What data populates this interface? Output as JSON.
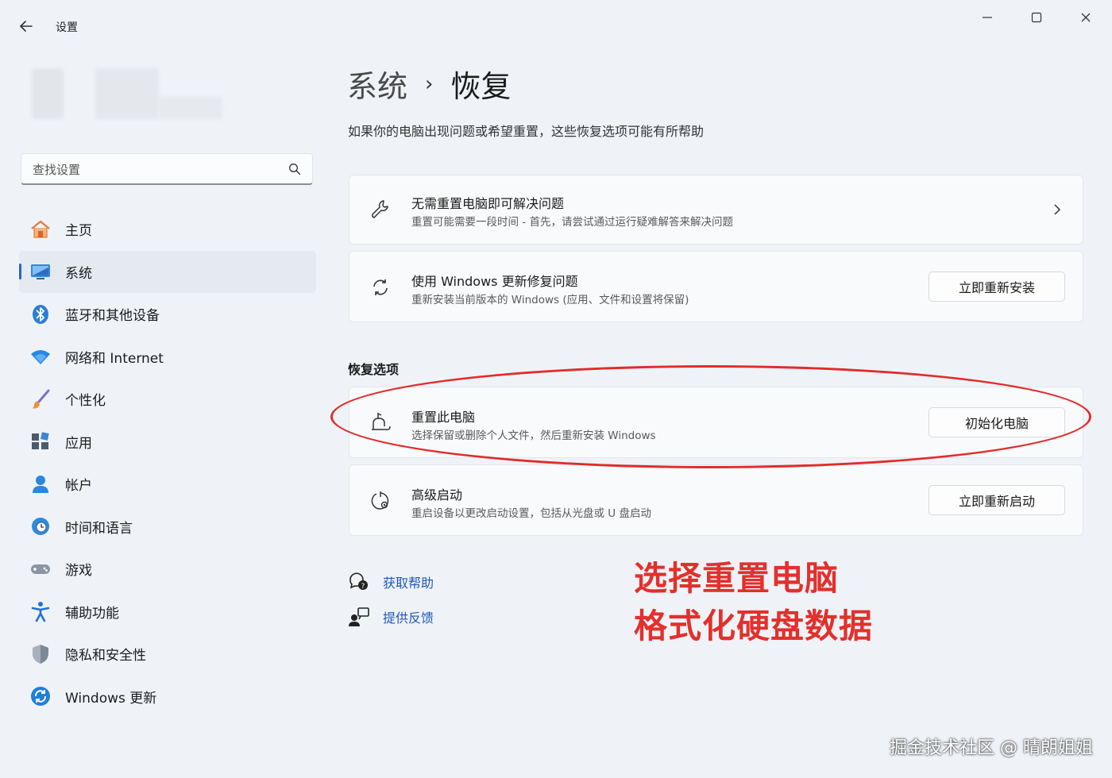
{
  "app": {
    "title": "设置"
  },
  "search": {
    "placeholder": "查找设置"
  },
  "sidebar": {
    "items": [
      {
        "label": "主页",
        "icon": "home-icon"
      },
      {
        "label": "系统",
        "icon": "system-icon",
        "active": true
      },
      {
        "label": "蓝牙和其他设备",
        "icon": "bluetooth-icon"
      },
      {
        "label": "网络和 Internet",
        "icon": "wifi-icon"
      },
      {
        "label": "个性化",
        "icon": "brush-icon"
      },
      {
        "label": "应用",
        "icon": "apps-icon"
      },
      {
        "label": "帐户",
        "icon": "account-icon"
      },
      {
        "label": "时间和语言",
        "icon": "clock-globe-icon"
      },
      {
        "label": "游戏",
        "icon": "gamepad-icon"
      },
      {
        "label": "辅助功能",
        "icon": "accessibility-icon"
      },
      {
        "label": "隐私和安全性",
        "icon": "shield-icon"
      },
      {
        "label": "Windows 更新",
        "icon": "update-icon"
      }
    ]
  },
  "main": {
    "breadcrumb_parent": "系统",
    "breadcrumb_sep": "›",
    "breadcrumb_current": "恢复",
    "description": "如果你的电脑出现问题或希望重置，这些恢复选项可能有所帮助",
    "cards_top": [
      {
        "title": "无需重置电脑即可解决问题",
        "subtitle": "重置可能需要一段时间 - 首先，请尝试通过运行疑难解答来解决问题"
      },
      {
        "title": "使用 Windows 更新修复问题",
        "subtitle": "重新安装当前版本的 Windows (应用、文件和设置将保留)",
        "button": "立即重新安装"
      }
    ],
    "section_title": "恢复选项",
    "recovery_options": [
      {
        "title": "重置此电脑",
        "subtitle": "选择保留或删除个人文件，然后重新安装 Windows",
        "button": "初始化电脑"
      },
      {
        "title": "高级启动",
        "subtitle": "重启设备以更改启动设置，包括从光盘或 U 盘启动",
        "button": "立即重新启动"
      }
    ],
    "links": [
      {
        "label": "获取帮助",
        "icon": "help-chat-icon"
      },
      {
        "label": "提供反馈",
        "icon": "feedback-icon"
      }
    ]
  },
  "annotation": {
    "line1": "选择重置电脑",
    "line2": "格式化硬盘数据",
    "color": "#e3302c"
  },
  "watermark": "掘金技术社区 @ 晴朗姐姐",
  "colors": {
    "accent": "#2a63c9",
    "link": "#1f58b8",
    "highlight": "#e32b2b"
  }
}
